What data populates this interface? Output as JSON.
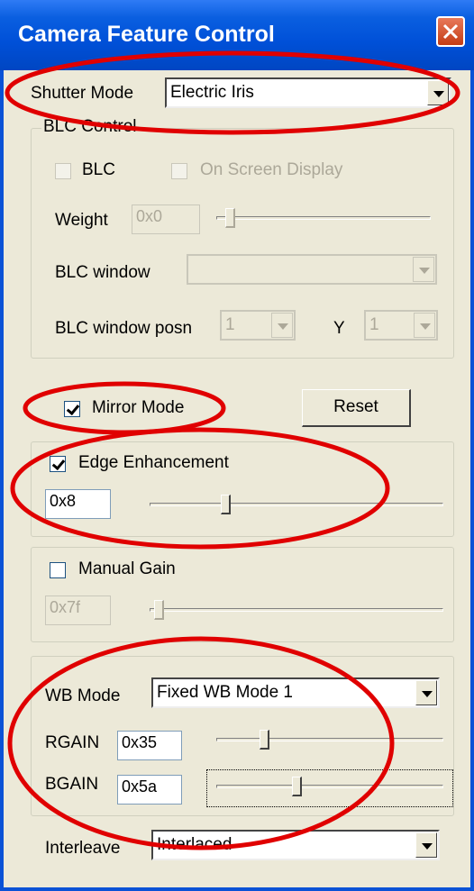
{
  "window": {
    "title": "Camera Feature Control"
  },
  "shutter": {
    "label": "Shutter Mode",
    "value": "Electric Iris"
  },
  "blc": {
    "group_label": "BLC Control",
    "blc_label": "BLC",
    "osd_label": "On Screen Display",
    "weight_label": "Weight",
    "weight_value": "0x0",
    "weight_slider_fraction": 0.0,
    "window_label": "BLC window",
    "window_value": "",
    "posn_label": "BLC window posn",
    "posn_x_value": "1",
    "y_label": "Y",
    "posn_y_value": "1"
  },
  "mirror": {
    "label": "Mirror Mode",
    "checked": true
  },
  "reset": {
    "label": "Reset"
  },
  "edge": {
    "label": "Edge Enhancement",
    "checked": true,
    "value": "0x8",
    "slider_fraction": 0.25
  },
  "gain": {
    "label": "Manual Gain",
    "checked": false,
    "value": "0x7f",
    "slider_fraction": 0.0
  },
  "wb": {
    "mode_label": "WB Mode",
    "mode_value": "Fixed WB Mode 1",
    "rgain_label": "RGAIN",
    "rgain_value": "0x35",
    "rgain_slider_fraction": 0.2,
    "bgain_label": "BGAIN",
    "bgain_value": "0x5a",
    "bgain_slider_fraction": 0.35
  },
  "interleave": {
    "label": "Interleave",
    "value": "Interlaced"
  },
  "colors": {
    "titlebar": "#0050d8",
    "background": "#ece9d8",
    "annotation": "#e00000",
    "close_button": "#d9532c"
  }
}
